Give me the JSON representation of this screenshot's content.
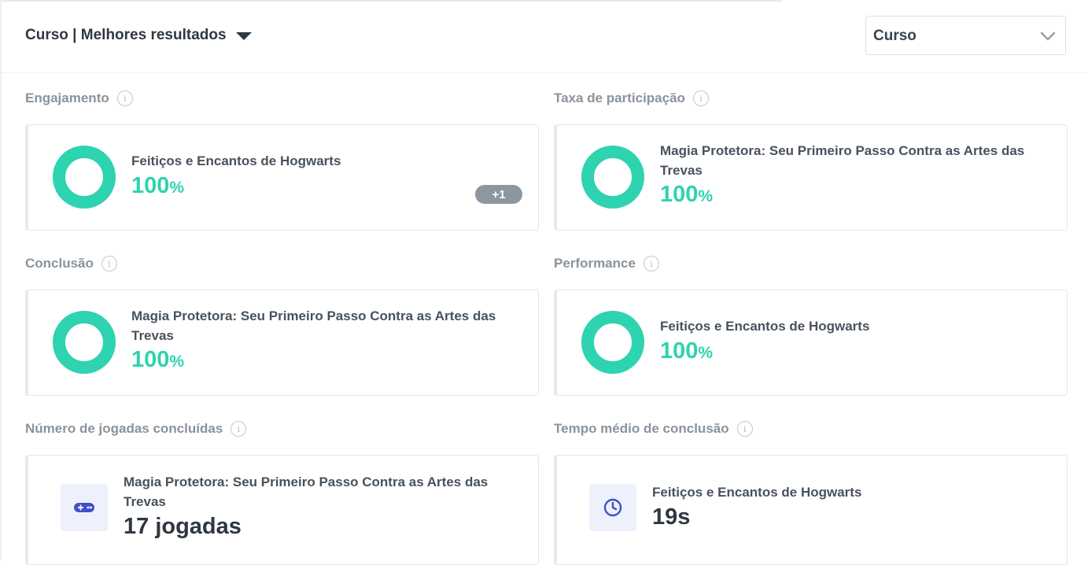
{
  "header": {
    "title": "Curso | Melhores resultados"
  },
  "filter": {
    "selected": "Curso"
  },
  "colors": {
    "accent": "#2ed3b0",
    "badge": "#8e979f",
    "icon_bg": "#eef1fb",
    "icon_fg": "#4150c8"
  },
  "metrics": {
    "engajamento": {
      "label": "Engajamento",
      "name": "Feitiços e Encantos de Hogwarts",
      "value": "100",
      "unit": "%",
      "percent": 100,
      "extra": "+1"
    },
    "participacao": {
      "label": "Taxa de participação",
      "name": "Magia Protetora: Seu Primeiro Passo Contra as Artes das Trevas",
      "value": "100",
      "unit": "%",
      "percent": 100
    },
    "conclusao": {
      "label": "Conclusão",
      "name": "Magia Protetora: Seu Primeiro Passo Contra as Artes das Trevas",
      "value": "100",
      "unit": "%",
      "percent": 100
    },
    "performance": {
      "label": "Performance",
      "name": "Feitiços e Encantos de Hogwarts",
      "value": "100",
      "unit": "%",
      "percent": 100
    },
    "jogadas": {
      "label": "Número de jogadas concluídas",
      "name": "Magia Protetora: Seu Primeiro Passo Contra as Artes das Trevas",
      "value": "17 jogadas",
      "icon": "gamepad-icon"
    },
    "tempo": {
      "label": "Tempo médio de conclusão",
      "name": "Feitiços e Encantos de Hogwarts",
      "value": "19s",
      "icon": "clock-icon"
    }
  }
}
